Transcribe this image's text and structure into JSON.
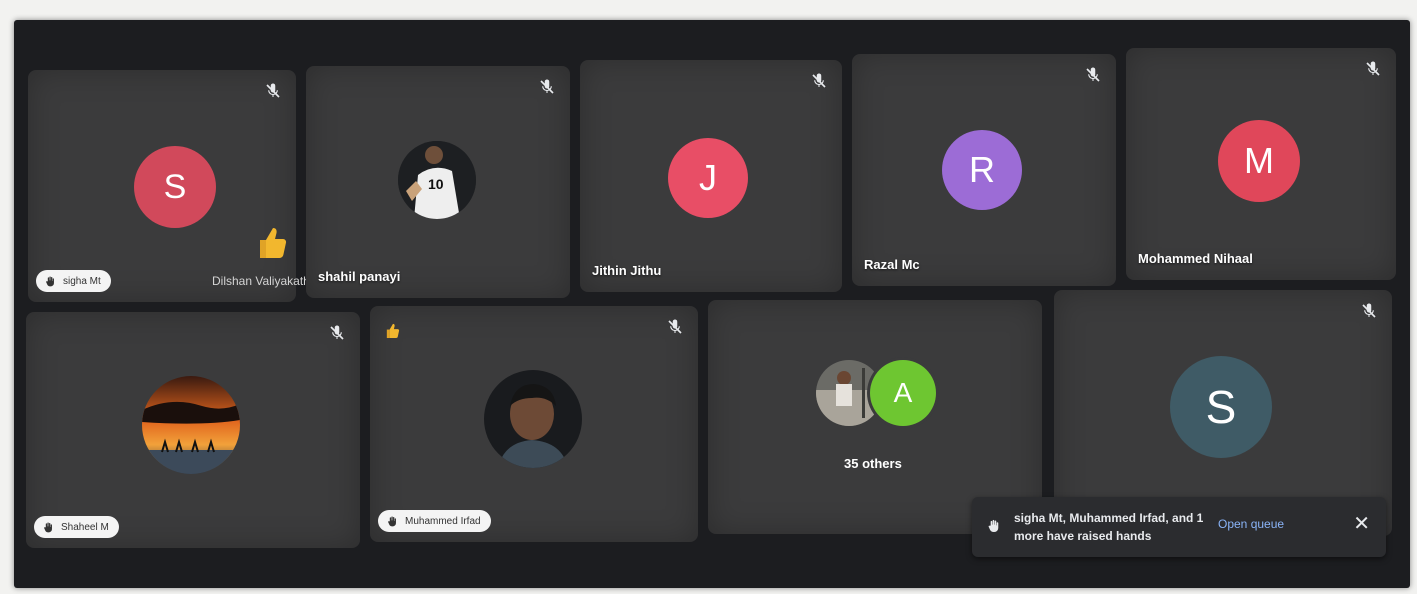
{
  "colors": {
    "tile_bg": "#3b3b3c",
    "avatar_s1": "#d1495b",
    "avatar_j": "#e84e66",
    "avatar_r": "#9c6cd6",
    "avatar_m": "#e0475a",
    "avatar_a": "#6ec631",
    "avatar_s2": "#3f5b66",
    "link_blue": "#8ab4f8"
  },
  "participants_row1": [
    {
      "initial": "S",
      "chip_name": "sigha Mt",
      "hand_raised": true,
      "muted": true
    },
    {
      "name": "shahil panayi",
      "muted": true
    },
    {
      "initial": "J",
      "name": "Jithin Jithu",
      "muted": true
    },
    {
      "initial": "R",
      "name": "Razal Mc",
      "muted": true
    },
    {
      "initial": "M",
      "name": "Mohammed Nihaal",
      "muted": true
    }
  ],
  "floating_name": "Dilshan Valiyakath",
  "participants_row2": [
    {
      "chip_name": "Shaheel M",
      "hand_raised": true,
      "muted": true
    },
    {
      "chip_name": "Muhammed Irfad",
      "hand_raised": true,
      "muted": true,
      "reaction": "thumbs-up"
    },
    {
      "initial": "A",
      "others_label": "35 others"
    },
    {
      "initial": "S",
      "muted": true
    }
  ],
  "toast": {
    "message": "sigha Mt, Muhammed Irfad, and 1 more have raised hands",
    "action_label": "Open queue",
    "close_label": "✕"
  }
}
